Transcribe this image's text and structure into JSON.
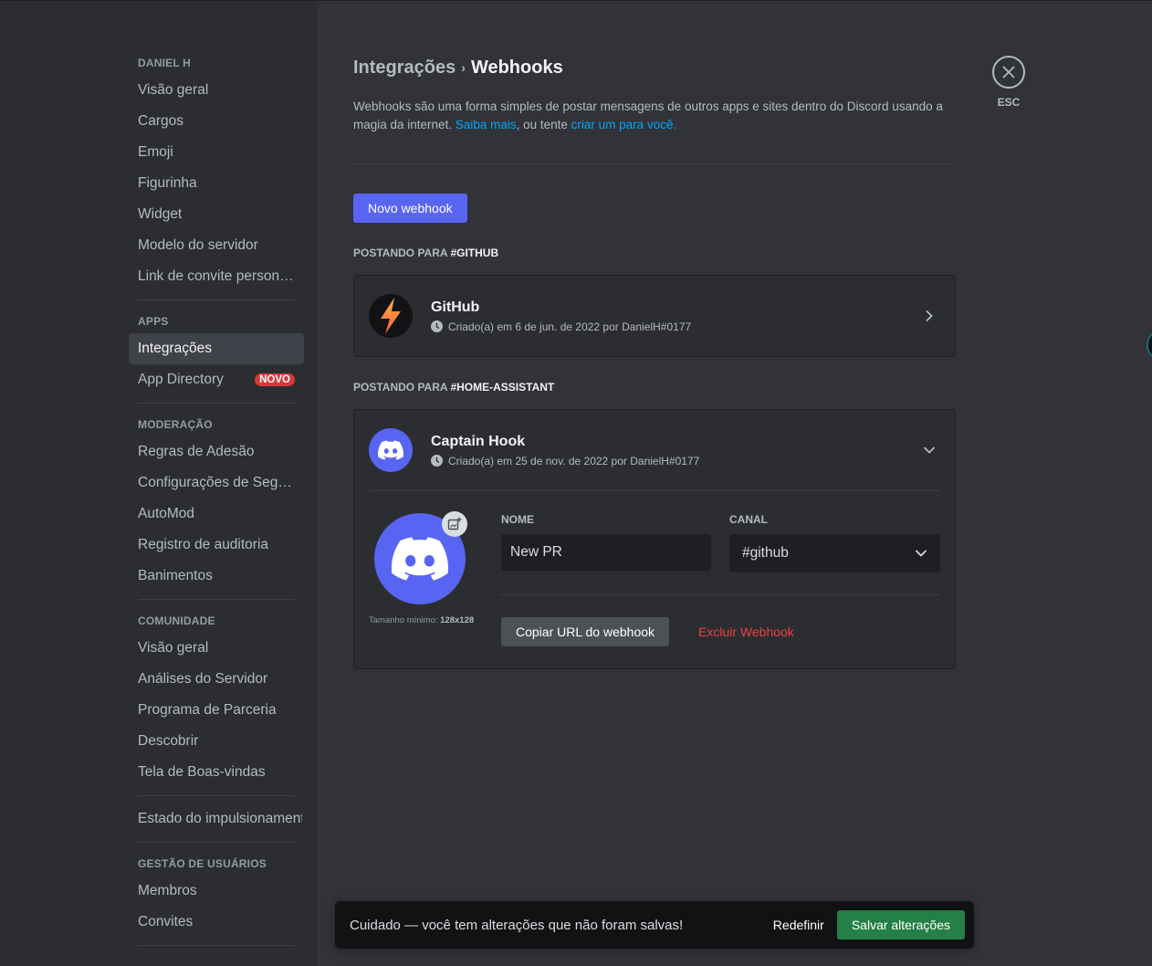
{
  "sidebar": {
    "sections": [
      {
        "header": "DANIEL H",
        "items": [
          {
            "label": "Visão geral"
          },
          {
            "label": "Cargos"
          },
          {
            "label": "Emoji"
          },
          {
            "label": "Figurinha"
          },
          {
            "label": "Widget"
          },
          {
            "label": "Modelo do servidor"
          },
          {
            "label": "Link de convite persona..."
          }
        ]
      },
      {
        "header": "APPS",
        "items": [
          {
            "label": "Integrações",
            "active": true
          },
          {
            "label": "App Directory",
            "badge": "NOVO"
          }
        ]
      },
      {
        "header": "MODERAÇÃO",
        "items": [
          {
            "label": "Regras de Adesão"
          },
          {
            "label": "Configurações de Segur..."
          },
          {
            "label": "AutoMod"
          },
          {
            "label": "Registro de auditoria"
          },
          {
            "label": "Banimentos"
          }
        ]
      },
      {
        "header": "COMUNIDADE",
        "items": [
          {
            "label": "Visão geral"
          },
          {
            "label": "Análises do Servidor"
          },
          {
            "label": "Programa de Parceria"
          },
          {
            "label": "Descobrir"
          },
          {
            "label": "Tela de Boas-vindas"
          }
        ]
      },
      {
        "header": "",
        "items": [
          {
            "label": "Estado do impulsionamento"
          }
        ]
      },
      {
        "header": "GESTÃO DE USUÁRIOS",
        "items": [
          {
            "label": "Membros"
          },
          {
            "label": "Convites"
          }
        ]
      }
    ]
  },
  "header": {
    "breadcrumb_parent": "Integrações",
    "breadcrumb_sep": "›",
    "breadcrumb_current": "Webhooks"
  },
  "description": {
    "text": "Webhooks são uma forma simples de postar mensagens de outros apps e sites dentro do Discord usando a magia da internet. ",
    "link1": "Saiba mais",
    "middle": ", ou tente ",
    "link2": "criar um para você."
  },
  "new_webhook_label": "Novo webhook",
  "close": {
    "label": "ESC"
  },
  "webhooks": [
    {
      "posting_prefix": "POSTANDO PARA ",
      "channel": "#GITHUB",
      "name": "GitHub",
      "meta": "Criado(a) em 6 de jun. de 2022 por DanielH#0177",
      "avatar_icon": "lightning-icon",
      "expanded": false
    },
    {
      "posting_prefix": "POSTANDO PARA ",
      "channel": "#HOME-ASSISTANT",
      "name": "Captain Hook",
      "meta": "Criado(a) em 25 de nov. de 2022 por DanielH#0177",
      "avatar_icon": "discord-logo-icon",
      "expanded": true,
      "form": {
        "min_size_label": "Tamanho mínimo: ",
        "min_size_value": "128x128",
        "name_label": "NOME",
        "name_value": "New PR",
        "channel_label": "CANAL",
        "channel_value": "#github",
        "copy_url_label": "Copiar URL do webhook",
        "delete_label": "Excluir Webhook"
      }
    }
  ],
  "unsaved": {
    "message": "Cuidado — você tem alterações que não foram salvas!",
    "reset_label": "Redefinir",
    "save_label": "Salvar alterações"
  },
  "colors": {
    "accent": "#5865f2",
    "success": "#248046",
    "danger": "#f23f42",
    "link": "#00a8fc"
  }
}
